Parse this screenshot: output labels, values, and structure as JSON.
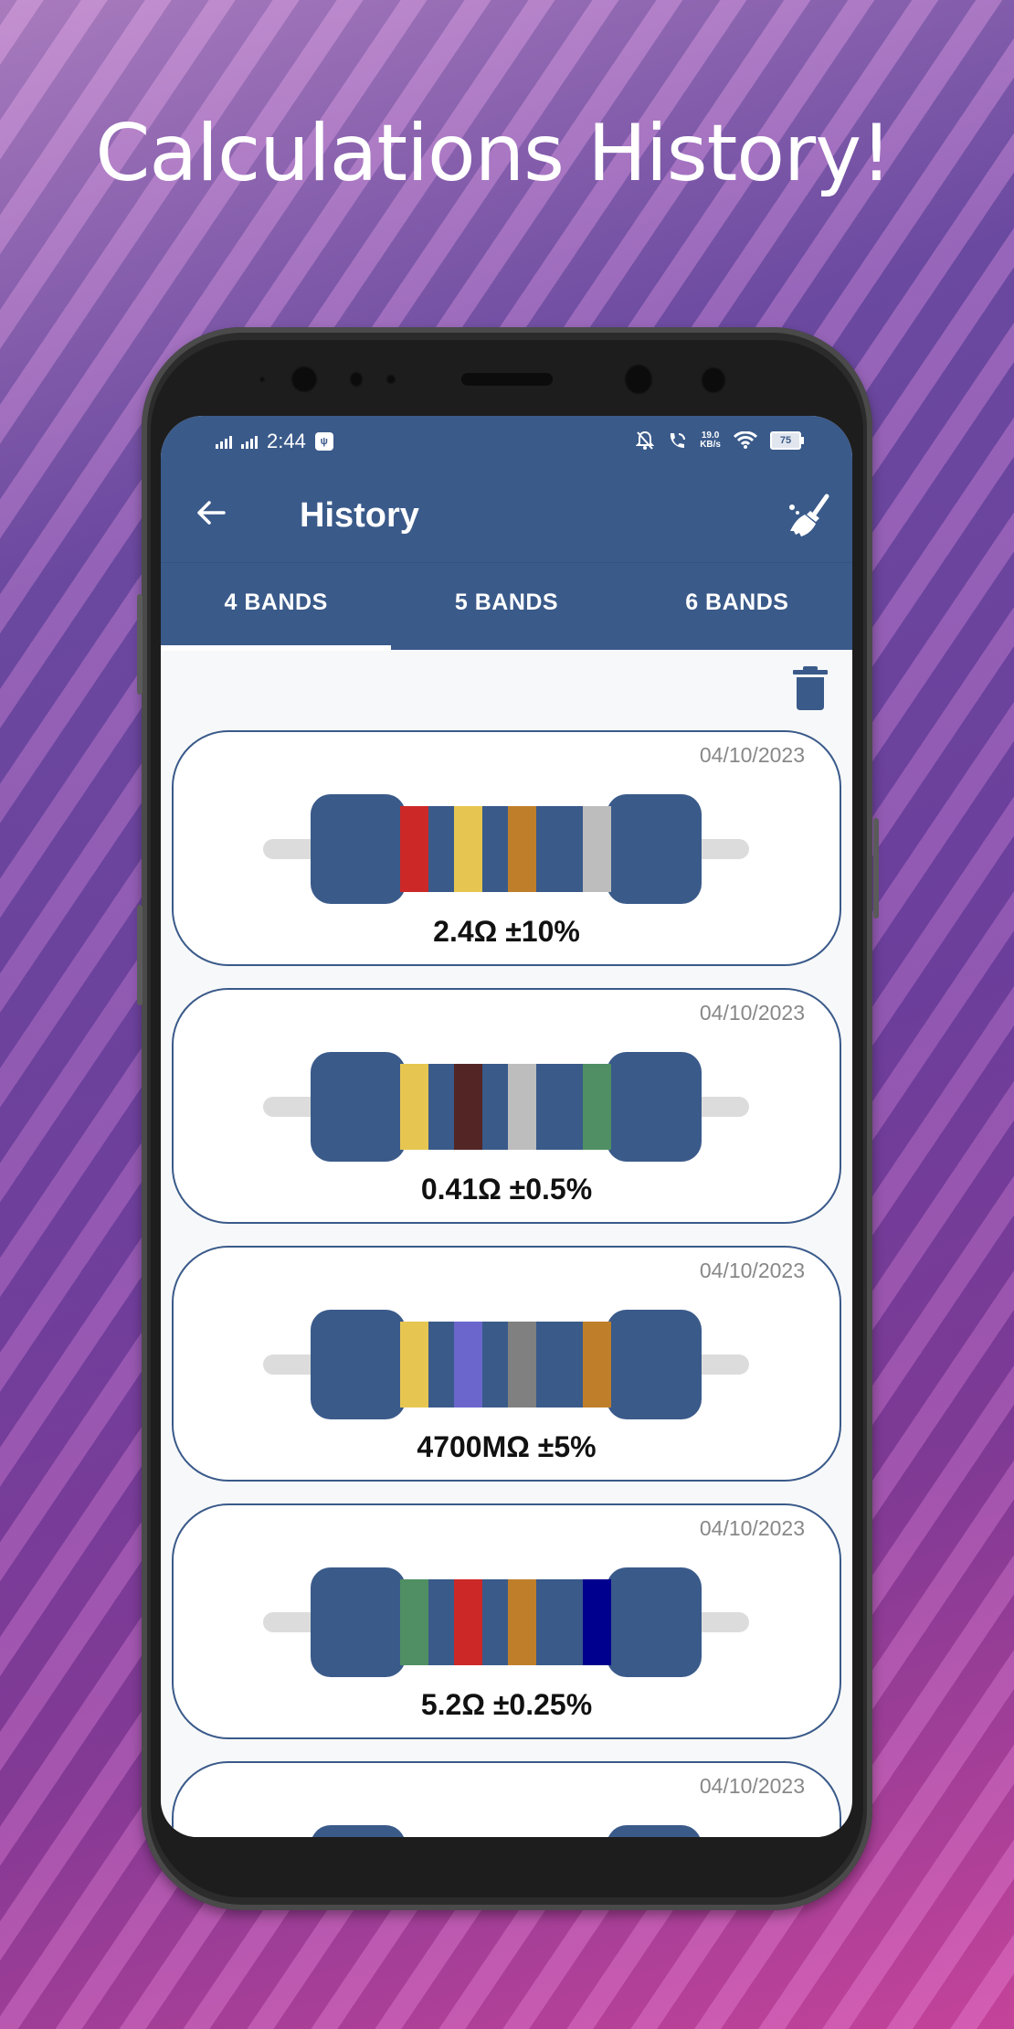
{
  "promo": {
    "title": "Calculations History!"
  },
  "status_bar": {
    "time": "2:44",
    "usb_badge": "ψ",
    "net_speed_value": "19.0",
    "net_speed_unit": "KB/s",
    "battery": "75"
  },
  "toolbar": {
    "title": "History",
    "back_icon": "arrow-left-icon",
    "clear_icon": "broom-icon"
  },
  "tabs": [
    {
      "label": "4 BANDS",
      "active": true
    },
    {
      "label": "5 BANDS",
      "active": false
    },
    {
      "label": "6 BANDS",
      "active": false
    }
  ],
  "actions": {
    "delete_icon": "trash-icon"
  },
  "colors": {
    "primary": "#3a5a8a",
    "background": "#f7f8f9",
    "date_text": "#888888",
    "lead": "#dcdcdc"
  },
  "history": [
    {
      "date": "04/10/2023",
      "value": "2.4Ω ±10%",
      "bands": [
        "#cc2828",
        "#e6c650",
        "#bf7f2a",
        "#bdbdbd"
      ]
    },
    {
      "date": "04/10/2023",
      "value": "0.41Ω ±0.5%",
      "bands": [
        "#e6c650",
        "#542525",
        "#bdbdbd",
        "#4f8f63"
      ]
    },
    {
      "date": "04/10/2023",
      "value": "4700MΩ ±5%",
      "bands": [
        "#e6c650",
        "#6a66cc",
        "#808080",
        "#bf7f2a"
      ]
    },
    {
      "date": "04/10/2023",
      "value": "5.2Ω ±0.25%",
      "bands": [
        "#4f8f63",
        "#cc2828",
        "#bf7f2a",
        "#00008f"
      ]
    },
    {
      "date": "04/10/2023",
      "value": "",
      "bands": []
    }
  ]
}
